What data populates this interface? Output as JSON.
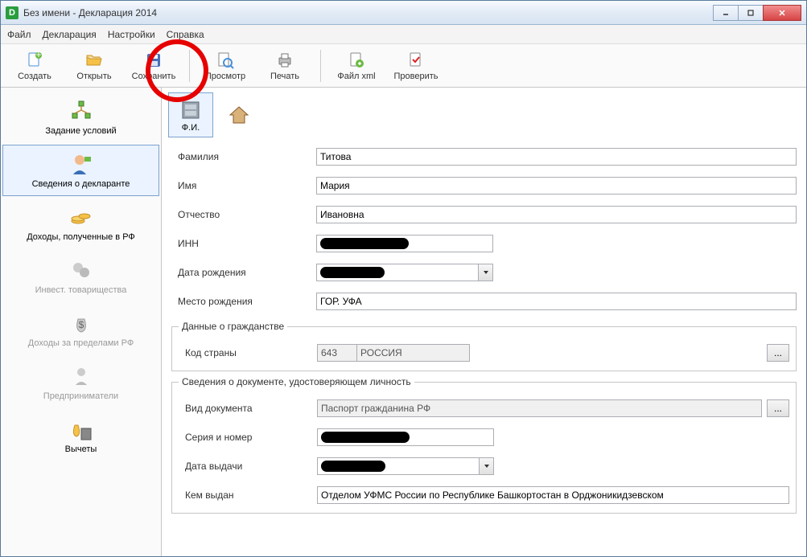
{
  "window": {
    "title": "Без имени - Декларация 2014"
  },
  "menu": {
    "file": "Файл",
    "declaration": "Декларация",
    "settings": "Настройки",
    "help": "Справка"
  },
  "toolbar": {
    "create": "Создать",
    "open": "Открыть",
    "save": "Сохранить",
    "preview": "Просмотр",
    "print": "Печать",
    "filexml": "Файл xml",
    "check": "Проверить"
  },
  "sidebar": {
    "items": [
      {
        "label": "Задание условий"
      },
      {
        "label": "Сведения о декларанте"
      },
      {
        "label": "Доходы, полученные в РФ"
      },
      {
        "label": "Инвест. товарищества"
      },
      {
        "label": "Доходы за пределами РФ"
      },
      {
        "label": "Предприниматели"
      },
      {
        "label": "Вычеты"
      }
    ]
  },
  "subtoolbar": {
    "fio": "Ф.И."
  },
  "form": {
    "labels": {
      "lastname": "Фамилия",
      "firstname": "Имя",
      "patronymic": "Отчество",
      "inn": "ИНН",
      "dob": "Дата рождения",
      "birthplace": "Место рождения",
      "citizenship_section": "Данные о гражданстве",
      "countrycode": "Код страны",
      "iddoc_section": "Сведения о документе, удостоверяющем личность",
      "doctype": "Вид документа",
      "serial": "Серия и номер",
      "issuedate": "Дата выдачи",
      "issuedby": "Кем выдан"
    },
    "values": {
      "lastname": "Титова",
      "firstname": "Мария",
      "patronymic": "Ивановна",
      "inn": "",
      "dob": "",
      "birthplace": "ГОР. УФА",
      "countrycode": "643",
      "countryname": "РОССИЯ",
      "doctype": "Паспорт гражданина РФ",
      "serial": "",
      "issuedate": "",
      "issuedby": "Отделом УФМС России по Республике Башкортостан в Орджоникидзевском"
    }
  },
  "ellipsis": "..."
}
